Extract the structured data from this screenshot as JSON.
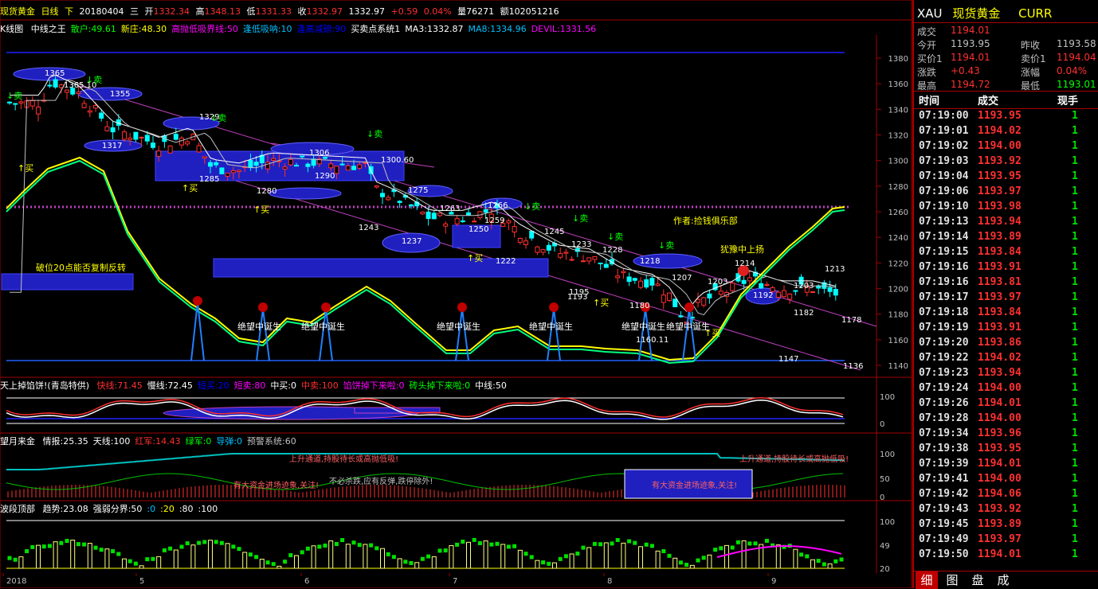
{
  "title_bar": {
    "name": "现货黄金",
    "period": "日线",
    "direction": "下",
    "date": "20180404",
    "weekday": "三",
    "open_label": "开",
    "open": "1332.34",
    "high_label": "高",
    "high": "1348.13",
    "low_label": "低",
    "low": "1331.33",
    "close_label": "收",
    "close": "1332.97",
    "close2": "1332.97",
    "change": "+0.59",
    "change_pct": "0.04%",
    "volume": "量76271",
    "amount": "额102051216"
  },
  "indicator_bar": {
    "chart_type": "K线图",
    "items": [
      {
        "text": "中线之王",
        "color": "#ffffff"
      },
      {
        "text": "散户:49.61",
        "color": "#00ff00"
      },
      {
        "text": "新庄:48.30",
        "color": "#ffff00"
      },
      {
        "text": "高抛低吸界线:50",
        "color": "#ff00ff"
      },
      {
        "text": "逢低吸呐:10",
        "color": "#00c0ff"
      },
      {
        "text": "逢高减磅:90",
        "color": "#0000ff"
      },
      {
        "text": "买卖点系统1",
        "color": "#ffffff"
      },
      {
        "text": "MA3:1332.87",
        "color": "#ffffff"
      },
      {
        "text": "MA8:1334.96",
        "color": "#00c0ff"
      },
      {
        "text": "DEVIL:1331.56",
        "color": "#ff00ff"
      }
    ]
  },
  "main_chart": {
    "y_ticks": [
      "1380",
      "1360",
      "1340",
      "1320",
      "1300",
      "1280",
      "1260",
      "1240",
      "1220",
      "1200",
      "1180",
      "1160",
      "1140"
    ],
    "x_ticks": [
      "2018",
      "5",
      "6",
      "7",
      "8",
      "9"
    ],
    "price_labels": [
      "1365",
      "1365.10",
      "1355",
      "1329",
      "1317",
      "1306",
      "1300.60",
      "1290",
      "1285",
      "1280",
      "1275",
      "1266",
      "1263",
      "1259",
      "1250",
      "1245",
      "1243",
      "1237",
      "1233",
      "1228",
      "1222",
      "1218",
      "1214",
      "1213",
      "1207",
      "1203",
      "1203",
      "1192",
      "1182",
      "1180",
      "1178",
      "1160.11",
      "1147",
      "1136",
      "1193",
      "1195"
    ],
    "signals": {
      "buy": "↑买",
      "sell": "↓卖"
    },
    "annotations": [
      "破位20点能否复制反转",
      "作者:捡钱俱乐部",
      "犹豫中上扬",
      "绝望中诞生"
    ]
  },
  "panel2": {
    "title": "天上掉馅饼!(青岛特供)",
    "items": [
      {
        "text": "快线:71.45",
        "color": "#ff3030"
      },
      {
        "text": "慢线:72.45",
        "color": "#ffffff"
      },
      {
        "text": "短买:20",
        "color": "#0000ff"
      },
      {
        "text": "短卖:80",
        "color": "#ff00ff"
      },
      {
        "text": "中买:0",
        "color": "#ffffff"
      },
      {
        "text": "中卖:100",
        "color": "#ff3030"
      },
      {
        "text": "馅饼掉下来啦:0",
        "color": "#ff00ff"
      },
      {
        "text": "砖头掉下来啦:0",
        "color": "#00ff00"
      },
      {
        "text": "中线:50",
        "color": "#ffffff"
      }
    ],
    "y_ticks": [
      "100",
      "0"
    ]
  },
  "panel3": {
    "title": "望月来金",
    "items": [
      {
        "text": "情报:25.35",
        "color": "#ffffff"
      },
      {
        "text": "天线:100",
        "color": "#ffffff"
      },
      {
        "text": "红军:14.43",
        "color": "#ff3030"
      },
      {
        "text": "绿军:0",
        "color": "#00ff00"
      },
      {
        "text": "导弹:0",
        "color": "#00c0ff"
      },
      {
        "text": "预警系统:60",
        "color": "#c0c0c0"
      }
    ],
    "notes": [
      "上升通道,持股待长或高抛低吸!",
      "上升通道,持股待长或高抛低吸!",
      "有大资金进场迹象,关注!",
      "有大资金进场迹象,关注!",
      "不必杀跌,应有反弹,跌停除外!"
    ],
    "y_ticks": [
      "100",
      "50",
      "0"
    ]
  },
  "panel4": {
    "title": "波段顶部",
    "items": [
      {
        "text": "趋势:23.08",
        "color": "#ffffff"
      },
      {
        "text": "强弱分界:50",
        "color": "#ffffff"
      },
      {
        "text": ":0",
        "color": "#00c0ff"
      },
      {
        "text": ":20",
        "color": "#ffff00"
      },
      {
        "text": ":80",
        "color": "#ffffff"
      },
      {
        "text": ":100",
        "color": "#ffffff"
      }
    ],
    "y_ticks": [
      "100",
      "49",
      "20"
    ]
  },
  "quote_panel": {
    "symbol": "XAU",
    "name": "现货黄金",
    "currency": "CURR",
    "rows": [
      {
        "k1": "成交",
        "v1": "1194.01",
        "c1": "#ff3030",
        "k2": "",
        "v2": "",
        "c2": "#ff3030"
      },
      {
        "k1": "今开",
        "v1": "1193.95",
        "c1": "#c0c0c0",
        "k2": "昨收",
        "v2": "1193.58",
        "c2": "#c0c0c0"
      },
      {
        "k1": "买价1",
        "v1": "1194.01",
        "c1": "#ff3030",
        "k2": "卖价1",
        "v2": "1194.04",
        "c2": "#ff3030"
      },
      {
        "k1": "涨跌",
        "v1": "+0.43",
        "c1": "#ff3030",
        "k2": "涨幅",
        "v2": "0.04%",
        "c2": "#ff3030"
      },
      {
        "k1": "最高",
        "v1": "1194.72",
        "c1": "#ff3030",
        "k2": "最低",
        "v2": "1193.01",
        "c2": "#00ff00"
      }
    ],
    "headers": {
      "time": "时间",
      "price": "成交",
      "hand": "现手"
    },
    "ticks": [
      {
        "time": "07:19:00",
        "price": "1193.95",
        "hand": "1"
      },
      {
        "time": "07:19:01",
        "price": "1194.02",
        "hand": "1"
      },
      {
        "time": "07:19:02",
        "price": "1194.00",
        "hand": "1"
      },
      {
        "time": "07:19:03",
        "price": "1193.92",
        "hand": "1"
      },
      {
        "time": "07:19:04",
        "price": "1193.95",
        "hand": "1"
      },
      {
        "time": "07:19:06",
        "price": "1193.97",
        "hand": "1"
      },
      {
        "time": "07:19:10",
        "price": "1193.98",
        "hand": "1"
      },
      {
        "time": "07:19:13",
        "price": "1193.94",
        "hand": "1"
      },
      {
        "time": "07:19:14",
        "price": "1193.89",
        "hand": "1"
      },
      {
        "time": "07:19:15",
        "price": "1193.84",
        "hand": "1"
      },
      {
        "time": "07:19:16",
        "price": "1193.91",
        "hand": "1"
      },
      {
        "time": "07:19:16",
        "price": "1193.81",
        "hand": "1"
      },
      {
        "time": "07:19:17",
        "price": "1193.97",
        "hand": "1"
      },
      {
        "time": "07:19:18",
        "price": "1193.84",
        "hand": "1"
      },
      {
        "time": "07:19:19",
        "price": "1193.91",
        "hand": "1"
      },
      {
        "time": "07:19:20",
        "price": "1193.86",
        "hand": "1"
      },
      {
        "time": "07:19:22",
        "price": "1194.02",
        "hand": "1"
      },
      {
        "time": "07:19:23",
        "price": "1193.94",
        "hand": "1"
      },
      {
        "time": "07:19:24",
        "price": "1194.00",
        "hand": "1"
      },
      {
        "time": "07:19:26",
        "price": "1194.01",
        "hand": "1"
      },
      {
        "time": "07:19:28",
        "price": "1194.00",
        "hand": "1"
      },
      {
        "time": "07:19:34",
        "price": "1193.96",
        "hand": "1"
      },
      {
        "time": "07:19:38",
        "price": "1193.95",
        "hand": "1"
      },
      {
        "time": "07:19:39",
        "price": "1194.01",
        "hand": "1"
      },
      {
        "time": "07:19:41",
        "price": "1194.00",
        "hand": "1"
      },
      {
        "time": "07:19:42",
        "price": "1194.06",
        "hand": "1"
      },
      {
        "time": "07:19:43",
        "price": "1193.92",
        "hand": "1"
      },
      {
        "time": "07:19:45",
        "price": "1193.89",
        "hand": "1"
      },
      {
        "time": "07:19:49",
        "price": "1193.97",
        "hand": "1"
      },
      {
        "time": "07:19:50",
        "price": "1194.01",
        "hand": "1"
      }
    ],
    "tabs": [
      "细",
      "图",
      "盘",
      "成"
    ]
  }
}
